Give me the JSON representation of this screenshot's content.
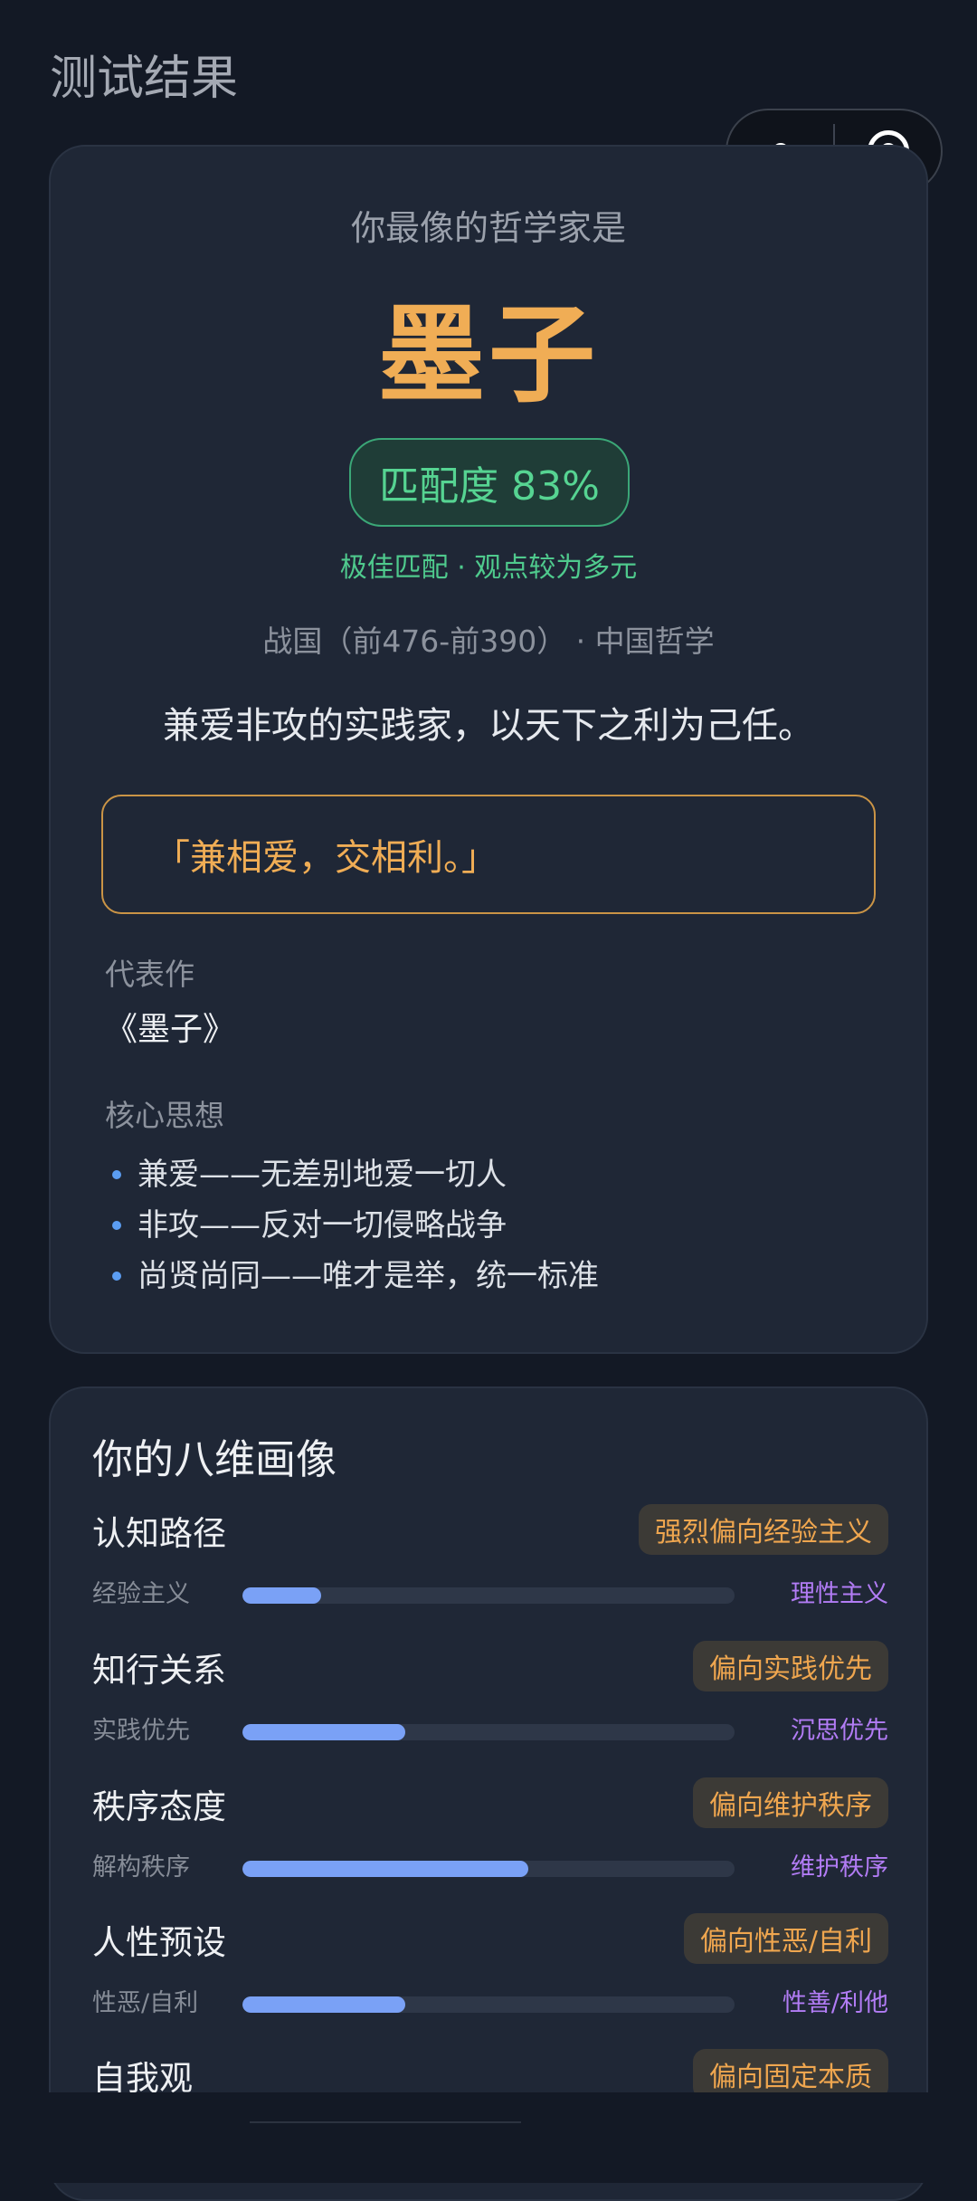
{
  "page": {
    "title": "测试结果"
  },
  "result": {
    "subtitle": "你最像的哲学家是",
    "name": "墨子",
    "match_label": "匹配度 83%",
    "match_percent": 83,
    "match_desc": "极佳匹配 · 观点较为多元",
    "era": "战国（前476-前390） · 中国哲学",
    "motto": "兼爱非攻的实践家，以天下之利为己任。",
    "quote": "「兼相爱，交相利。」",
    "works_label": "代表作",
    "works": "《墨子》",
    "ideas_label": "核心思想",
    "ideas": [
      "兼爱——无差别地爱一切人",
      "非攻——反对一切侵略战争",
      "尚贤尚同——唯才是举，统一标准"
    ]
  },
  "portrait": {
    "title": "你的八维画像",
    "dimensions": [
      {
        "name": "认知路径",
        "tag": "强烈偏向经验主义",
        "left": "经验主义",
        "right": "理性主义",
        "value": 0.16
      },
      {
        "name": "知行关系",
        "tag": "偏向实践优先",
        "left": "实践优先",
        "right": "沉思优先",
        "value": 0.33
      },
      {
        "name": "秩序态度",
        "tag": "偏向维护秩序",
        "left": "解构秩序",
        "right": "维护秩序",
        "value": 0.58
      },
      {
        "name": "人性预设",
        "tag": "偏向性恶/自利",
        "left": "性恶/自利",
        "right": "性善/利他",
        "value": 0.33
      },
      {
        "name": "自我观",
        "tag": "偏向固定本质"
      }
    ]
  },
  "colors": {
    "accent": "#f0ad55",
    "match_green": "#56d492",
    "bar_fill": "#7aa1f6",
    "right_pole": "#b27cf5",
    "background": "#131925",
    "card": "#1f2736"
  },
  "icons": {
    "menu": "more-dots-icon",
    "close": "target-close-icon"
  }
}
